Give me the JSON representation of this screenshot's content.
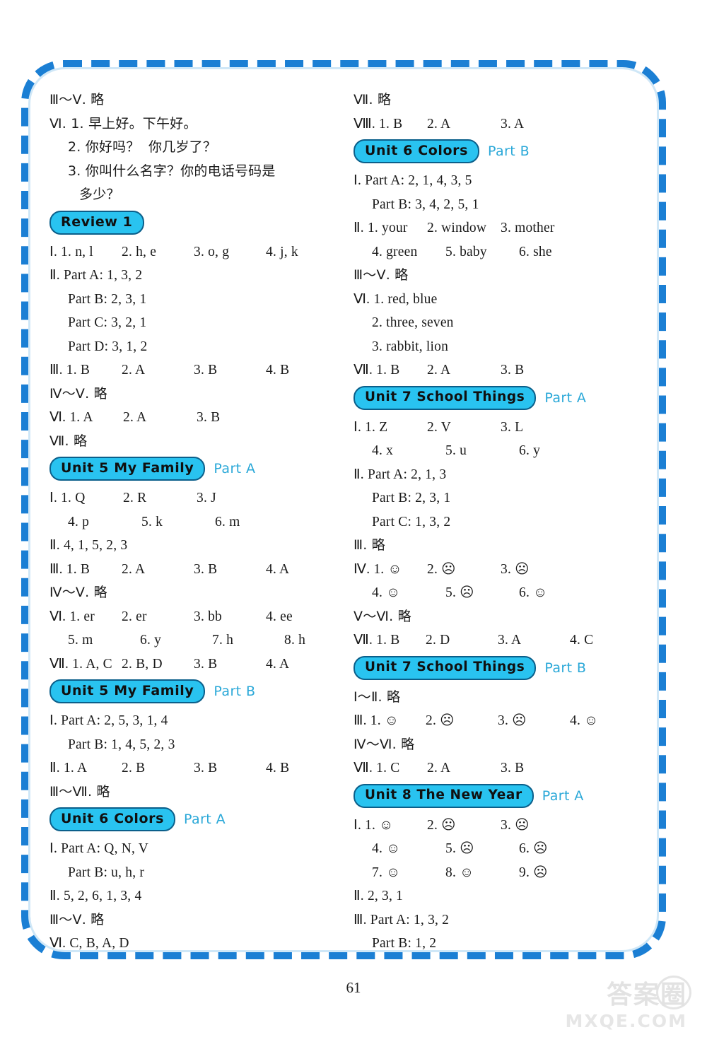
{
  "page": {
    "number": "61",
    "watermark_cn": "答案圈",
    "watermark_en": "MXQE.COM"
  },
  "left_column": {
    "blocks": [
      {
        "type": "text",
        "indent": 0,
        "text": "Ⅲ～Ⅴ. 略"
      },
      {
        "type": "text",
        "indent": 0,
        "text": "Ⅵ. 1. 早上好。下午好。"
      },
      {
        "type": "text",
        "indent": 1,
        "text": "2. 你好吗？  你几岁了？"
      },
      {
        "type": "text",
        "indent": 1,
        "text": "3. 你叫什么名字？你的电话号码是"
      },
      {
        "type": "text",
        "indent": 2,
        "text": "多少？"
      },
      {
        "type": "heading",
        "title": "Review 1",
        "part": ""
      },
      {
        "type": "cols4",
        "indent": 0,
        "lead": "Ⅰ. 1. n, l",
        "items": [
          "2. h, e",
          "3. o, g",
          "4. j, k"
        ]
      },
      {
        "type": "text",
        "indent": 0,
        "text": "Ⅱ. Part A: 1, 3, 2"
      },
      {
        "type": "text",
        "indent": 1,
        "text": "Part B: 2, 3, 1"
      },
      {
        "type": "text",
        "indent": 1,
        "text": "Part C: 3, 2, 1"
      },
      {
        "type": "text",
        "indent": 1,
        "text": "Part D: 3, 1, 2"
      },
      {
        "type": "cols4",
        "indent": 0,
        "lead": "Ⅲ. 1. B",
        "items": [
          "2. A",
          "3. B",
          "4. B"
        ]
      },
      {
        "type": "text",
        "indent": 0,
        "text": "Ⅳ～Ⅴ. 略"
      },
      {
        "type": "cols3",
        "indent": 0,
        "lead": "Ⅵ. 1. A",
        "items": [
          "2. A",
          "3. B"
        ]
      },
      {
        "type": "text",
        "indent": 0,
        "text": "Ⅶ. 略"
      },
      {
        "type": "heading",
        "title": "Unit 5 My Family",
        "part": "Part A"
      },
      {
        "type": "cols3",
        "indent": 0,
        "lead": "Ⅰ. 1. Q",
        "items": [
          "2. R",
          "3. J"
        ]
      },
      {
        "type": "cols3",
        "indent": 1,
        "lead": "4. p",
        "items": [
          "5. k",
          "6. m"
        ]
      },
      {
        "type": "text",
        "indent": 0,
        "text": "Ⅱ. 4, 1, 5, 2, 3"
      },
      {
        "type": "cols4",
        "indent": 0,
        "lead": "Ⅲ. 1. B",
        "items": [
          "2. A",
          "3. B",
          "4. A"
        ]
      },
      {
        "type": "text",
        "indent": 0,
        "text": "Ⅳ～Ⅴ. 略"
      },
      {
        "type": "cols4",
        "indent": 0,
        "lead": "Ⅵ. 1. er",
        "items": [
          "2. er",
          "3. bb",
          "4. ee"
        ]
      },
      {
        "type": "cols4",
        "indent": 1,
        "lead": "5. m",
        "items": [
          "6. y",
          "7. h",
          "8. h"
        ]
      },
      {
        "type": "cols4",
        "indent": 0,
        "lead": "Ⅶ. 1. A, C",
        "items": [
          "2. B, D",
          "3. B",
          "4. A"
        ]
      },
      {
        "type": "heading",
        "title": "Unit 5 My Family",
        "part": "Part B"
      },
      {
        "type": "text",
        "indent": 0,
        "text": "Ⅰ. Part A: 2, 5, 3, 1, 4"
      },
      {
        "type": "text",
        "indent": 1,
        "text": "Part B: 1, 4, 5, 2, 3"
      },
      {
        "type": "cols4",
        "indent": 0,
        "lead": "Ⅱ. 1. A",
        "items": [
          "2. B",
          "3. B",
          "4. B"
        ]
      },
      {
        "type": "text",
        "indent": 0,
        "text": "Ⅲ～Ⅶ. 略"
      },
      {
        "type": "heading",
        "title": "Unit 6 Colors",
        "part": "Part A"
      },
      {
        "type": "text",
        "indent": 0,
        "text": "Ⅰ. Part A: Q, N, V"
      },
      {
        "type": "text",
        "indent": 1,
        "text": "Part B: u, h, r"
      },
      {
        "type": "text",
        "indent": 0,
        "text": "Ⅱ. 5, 2, 6, 1, 3, 4"
      },
      {
        "type": "text",
        "indent": 0,
        "text": "Ⅲ～Ⅴ. 略"
      },
      {
        "type": "text",
        "indent": 0,
        "text": "Ⅵ. C, B, A, D"
      }
    ]
  },
  "right_column": {
    "blocks": [
      {
        "type": "text",
        "indent": 0,
        "text": "Ⅶ. 略"
      },
      {
        "type": "cols3",
        "indent": 0,
        "lead": "Ⅷ. 1. B",
        "items": [
          "2. A",
          "3. A"
        ]
      },
      {
        "type": "heading",
        "title": "Unit 6 Colors",
        "part": "Part B"
      },
      {
        "type": "text",
        "indent": 0,
        "text": "Ⅰ. Part A: 2, 1, 4, 3, 5"
      },
      {
        "type": "text",
        "indent": 1,
        "text": "Part B: 3, 4, 2, 5, 1"
      },
      {
        "type": "cols3",
        "indent": 0,
        "lead": "Ⅱ. 1. your",
        "items": [
          "2. window",
          "3. mother"
        ]
      },
      {
        "type": "cols3",
        "indent": 1,
        "lead": "4. green",
        "items": [
          "5. baby",
          "6. she"
        ]
      },
      {
        "type": "text",
        "indent": 0,
        "text": "Ⅲ～Ⅴ. 略"
      },
      {
        "type": "text",
        "indent": 0,
        "text": "Ⅵ. 1. red, blue"
      },
      {
        "type": "text",
        "indent": 1,
        "text": "2. three, seven"
      },
      {
        "type": "text",
        "indent": 1,
        "text": "3. rabbit, lion"
      },
      {
        "type": "cols3",
        "indent": 0,
        "lead": "Ⅶ. 1. B",
        "items": [
          "2. A",
          "3. B"
        ]
      },
      {
        "type": "heading",
        "title": "Unit 7 School Things",
        "part": "Part A"
      },
      {
        "type": "cols3",
        "indent": 0,
        "lead": "Ⅰ. 1. Z",
        "items": [
          "2. V",
          "3. L"
        ]
      },
      {
        "type": "cols3",
        "indent": 1,
        "lead": "4. x",
        "items": [
          "5. u",
          "6. y"
        ]
      },
      {
        "type": "text",
        "indent": 0,
        "text": "Ⅱ. Part A: 2, 1, 3"
      },
      {
        "type": "text",
        "indent": 1,
        "text": "Part B: 2, 3, 1"
      },
      {
        "type": "text",
        "indent": 1,
        "text": "Part C: 1, 3, 2"
      },
      {
        "type": "text",
        "indent": 0,
        "text": "Ⅲ. 略"
      },
      {
        "type": "cols3",
        "indent": 0,
        "lead": "Ⅳ. 1. ☺",
        "items": [
          "2. ☹",
          "3. ☹"
        ]
      },
      {
        "type": "cols3",
        "indent": 1,
        "lead": "4. ☺",
        "items": [
          "5. ☹",
          "6. ☺"
        ]
      },
      {
        "type": "text",
        "indent": 0,
        "text": "Ⅴ～Ⅵ. 略"
      },
      {
        "type": "cols4",
        "indent": 0,
        "lead": "Ⅶ. 1. B",
        "items": [
          "2. D",
          "3. A",
          "4. C"
        ]
      },
      {
        "type": "heading",
        "title": "Unit 7 School Things",
        "part": "Part B"
      },
      {
        "type": "text",
        "indent": 0,
        "text": "Ⅰ～Ⅱ. 略"
      },
      {
        "type": "cols4",
        "indent": 0,
        "lead": "Ⅲ. 1. ☺",
        "items": [
          "2. ☹",
          "3. ☹",
          "4. ☺"
        ]
      },
      {
        "type": "text",
        "indent": 0,
        "text": "Ⅳ～Ⅵ. 略"
      },
      {
        "type": "cols3",
        "indent": 0,
        "lead": "Ⅶ. 1. C",
        "items": [
          "2. A",
          "3. B"
        ]
      },
      {
        "type": "heading",
        "title": "Unit 8 The New Year",
        "part": "Part A"
      },
      {
        "type": "cols3",
        "indent": 0,
        "lead": "Ⅰ. 1. ☺",
        "items": [
          "2. ☹",
          "3. ☹"
        ]
      },
      {
        "type": "cols3",
        "indent": 1,
        "lead": "4. ☺",
        "items": [
          "5. ☹",
          "6. ☹"
        ]
      },
      {
        "type": "cols3",
        "indent": 1,
        "lead": "7. ☺",
        "items": [
          "8. ☺",
          "9. ☹"
        ]
      },
      {
        "type": "text",
        "indent": 0,
        "text": "Ⅱ. 2, 3, 1"
      },
      {
        "type": "text",
        "indent": 0,
        "text": "Ⅲ. Part A: 1, 3, 2"
      },
      {
        "type": "text",
        "indent": 1,
        "text": "Part B: 1, 2"
      }
    ]
  }
}
